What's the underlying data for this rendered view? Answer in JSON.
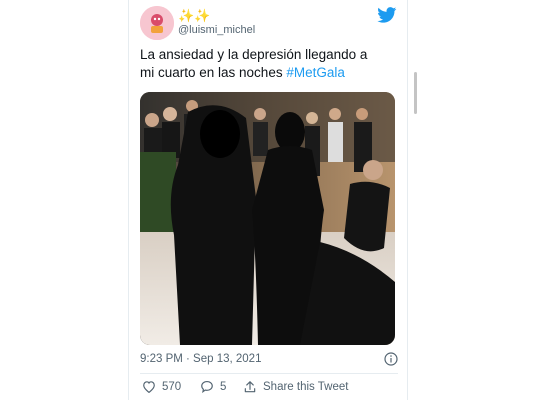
{
  "header": {
    "display_name": "✨✨",
    "handle": "@luismi_michel"
  },
  "tweet": {
    "text_line1": "La ansiedad y la depresión llegando a",
    "text_line2": "mi cuarto en las noches ",
    "hashtag": "#MetGala",
    "timestamp": "9:23 PM · Sep 13, 2021"
  },
  "actions": {
    "like_count": "570",
    "reply_count": "5",
    "share_label": "Share this Tweet"
  },
  "colors": {
    "brand_blue": "#1d9bf0",
    "text_primary": "#0f1419",
    "text_secondary": "#536471"
  },
  "icons": [
    "twitter-bird-icon",
    "info-icon",
    "heart-icon",
    "reply-bubble-icon",
    "share-icon"
  ]
}
